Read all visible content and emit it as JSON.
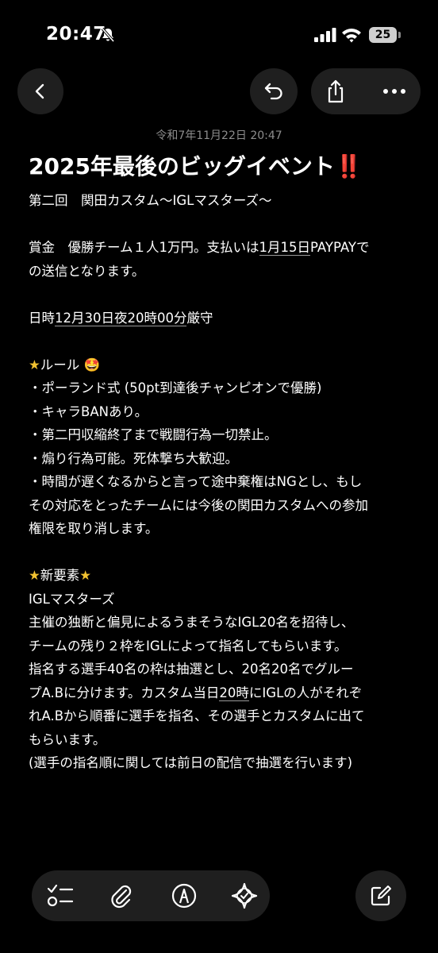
{
  "status_bar": {
    "time": "20:47",
    "battery": "25"
  },
  "note": {
    "date": "令和7年11月22日 20:47",
    "title": "2025年最後のビッグイベント",
    "title_emoji": "‼️",
    "lines": {
      "l1": "第二回　関田カスタム〜IGLマスターズ〜",
      "l2a": "賞金　優勝チーム１人1万円。支払いは",
      "l2b": "1月15日",
      "l2c": "PAYPAYで",
      "l3": "の送信となります。",
      "l4a": "日時",
      "l4b": "12月30日夜20時00分",
      "l4c": "厳守",
      "l5": "ルール",
      "l6": "・ポーランド式 (50pt到達後チャンピオンで優勝)",
      "l7": "・キャラBANあり。",
      "l8": "・第二円収縮終了まで戦闘行為一切禁止。",
      "l9": "・煽り行為可能。死体撃ち大歓迎。",
      "l10": "・時間が遅くなるからと言って途中棄権はNGとし、もし",
      "l11": "その対応をとったチームには今後の関田カスタムへの参加",
      "l12": "権限を取り消します。",
      "l13": "新要素",
      "l14": "IGLマスターズ",
      "l15": "主催の独断と偏見によるうまそうなIGL20名を招待し、",
      "l16": "チームの残り２枠をIGLによって指名してもらいます。",
      "l17": "指名する選手40名の枠は抽選とし、20名20名でグルー",
      "l18a": "プA.Bに分けます。カスタム当日",
      "l18b": "20時",
      "l18c": "にIGLの人がそれぞ",
      "l19": "れA.Bから順番に選手を指名、その選手とカスタムに出て",
      "l20": "もらいます。",
      "l21": "(選手の指名順に関しては前日の配信で抽選を行います)"
    }
  },
  "icons": {
    "back": "chevron-left-icon",
    "undo": "undo-icon",
    "share": "share-icon",
    "more": "ellipsis-icon",
    "checklist": "checklist-icon",
    "attach": "paperclip-icon",
    "markup": "pen-circle-icon",
    "ai": "sparkle-icon",
    "compose": "compose-icon"
  },
  "colors": {
    "background": "#000000",
    "control": "#1f1f1f",
    "accent_red": "#e0242d",
    "star": "#f2c230"
  }
}
